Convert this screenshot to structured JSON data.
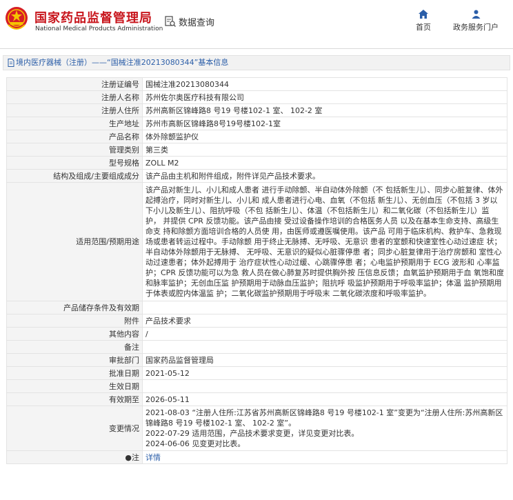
{
  "header": {
    "site_name": "国家药品监督管理局",
    "site_name_en": "National Medical Products Administration",
    "search_label": "数据查询",
    "nav": [
      {
        "label": "首页",
        "icon": "home-icon"
      },
      {
        "label": "政务服务门户",
        "icon": "user-icon"
      }
    ],
    "brand_color": "#c8161d",
    "link_color": "#2b5ea8"
  },
  "breadcrumb": {
    "text": "境内医疗器械（注册）——“国械注准20213080344”基本信息"
  },
  "rows": [
    {
      "label": "注册证编号",
      "value": "国械注准20213080344"
    },
    {
      "label": "注册人名称",
      "value": "苏州佐尔奥医疗科技有限公司"
    },
    {
      "label": "注册人住所",
      "value": "苏州高新区锦峰路8 号19 号楼102-1 室、 102-2 室"
    },
    {
      "label": "生产地址",
      "value": "苏州市高新区锦峰路8号19号楼102-1室"
    },
    {
      "label": "产品名称",
      "value": "体外除颤监护仪"
    },
    {
      "label": "管理类别",
      "value": "第三类"
    },
    {
      "label": "型号规格",
      "value": "ZOLL M2"
    },
    {
      "label": "结构及组成/主要组成成分",
      "value": "该产品由主机和附件组成，附件详见产品技术要求。"
    },
    {
      "label": "适用范围/预期用途",
      "value": "该产品对新生儿、小儿和成人患者 进行手动除颤、半自动体外除颤（不 包括新生儿）、同步心脏复律、体外 起搏治疗，同时对新生儿、小儿和 成人患者进行心电、血氧（不包括 新生儿）、无创血压（不包括 3 岁以 下小儿及新生儿）、阻抗呼吸（不包 括新生儿）、体温（不包括新生儿）和二氧化碳（不包括新生儿）监护， 并提供 CPR 反馈功能。该产品由接 受过设备操作培训的合格医务人员 以及在基本生命支持、高级生命支 持和除颤方面培训合格的人员使 用，由医师或遵医嘱使用。该产品 可用于临床机构、救护车、急救现 场或患者转运过程中。手动除颤 用于终止无脉搏、无呼吸、无意识 患者的室颤和快速室性心动过速症 状；半自动体外除颤用于无脉搏、 无呼吸、无意识的疑似心脏骤停患 者；同步心脏复律用于治疗房颤和 室性心动过速患者；体外起搏用于 治疗症状性心动过缓、心跳骤停患 者；心电监护预期用于 ECG 波形和 心率监护；CPR 反馈功能可以为急 救人员在做心肺复苏时提供胸外按 压信息反馈；血氧监护预期用于血 氧饱和度和脉率监护；无创血压监 护预期用于动脉血压监护；阻抗呼 吸监护预期用于呼吸率监护；体温 监护预期用于体表或腔内体温监 护；二氧化碳监护预期用于呼吸末 二氧化碳浓度和呼吸率监护。"
    },
    {
      "label": "产品储存条件及有效期",
      "value": ""
    },
    {
      "label": "附件",
      "value": "产品技术要求"
    },
    {
      "label": "其他内容",
      "value": "/"
    },
    {
      "label": "备注",
      "value": ""
    },
    {
      "label": "审批部门",
      "value": "国家药品监督管理局"
    },
    {
      "label": "批准日期",
      "value": "2021-05-12"
    },
    {
      "label": "生效日期",
      "value": ""
    },
    {
      "label": "有效期至",
      "value": "2026-05-11"
    },
    {
      "label": "变更情况",
      "value_lines": [
        "2021-08-03 “注册人住所:江苏省苏州高新区锦峰路8 号19 号楼102-1 室”变更为“注册人住所:苏州高新区锦峰路8 号19 号楼102-1 室、 102-2 室”。",
        "2022-07-29 适用范围，产品技术要求变更，详见变更对比表。",
        "2024-06-06 见变更对比表。"
      ]
    },
    {
      "label": "注",
      "value": "详情"
    }
  ]
}
